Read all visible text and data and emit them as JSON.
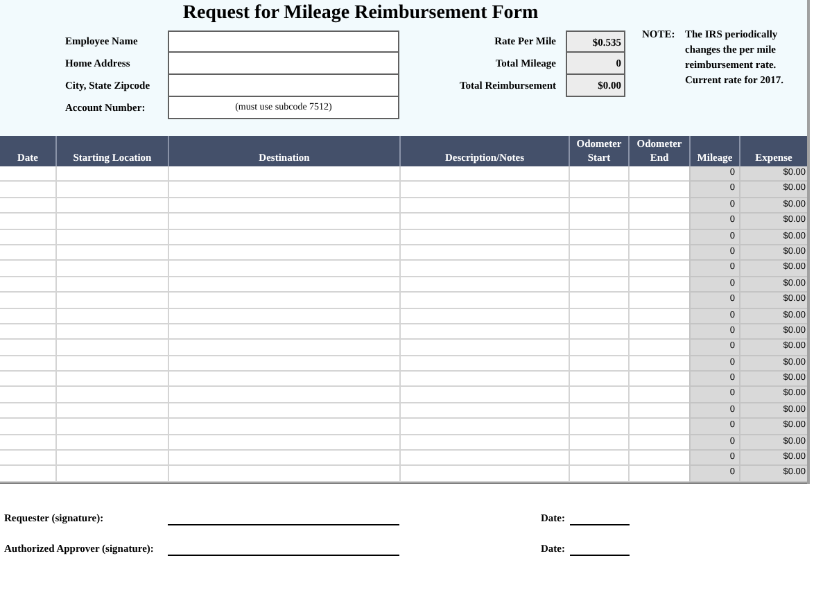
{
  "title": "Request for Mileage Reimbursement Form",
  "employee_fields": [
    {
      "label": "Employee Name"
    },
    {
      "label": "Home Address"
    },
    {
      "label": "City, State Zipcode"
    },
    {
      "label": "Account Number:",
      "value": "(must use subcode 7512)"
    }
  ],
  "summary_fields": [
    {
      "label": "Rate Per Mile",
      "value": "$0.535"
    },
    {
      "label": "Total Mileage",
      "value": "0"
    },
    {
      "label": "Total Reimbursement",
      "value": "$0.00"
    }
  ],
  "note": {
    "label": "NOTE:",
    "lines": [
      "The IRS periodically",
      "changes the per mile",
      "reimbursement rate.",
      "Current rate for 2017."
    ]
  },
  "table": {
    "columns": [
      [
        "Date"
      ],
      [
        "Starting Location"
      ],
      [
        "Destination"
      ],
      [
        "Description/Notes"
      ],
      [
        "Odometer",
        "Start"
      ],
      [
        "Odometer",
        "End"
      ],
      [
        "Mileage"
      ],
      [
        "Expense"
      ]
    ],
    "rows": [
      {
        "mileage": "0",
        "expense": "$0.00"
      },
      {
        "mileage": "0",
        "expense": "$0.00"
      },
      {
        "mileage": "0",
        "expense": "$0.00"
      },
      {
        "mileage": "0",
        "expense": "$0.00"
      },
      {
        "mileage": "0",
        "expense": "$0.00"
      },
      {
        "mileage": "0",
        "expense": "$0.00"
      },
      {
        "mileage": "0",
        "expense": "$0.00"
      },
      {
        "mileage": "0",
        "expense": "$0.00"
      },
      {
        "mileage": "0",
        "expense": "$0.00"
      },
      {
        "mileage": "0",
        "expense": "$0.00"
      },
      {
        "mileage": "0",
        "expense": "$0.00"
      },
      {
        "mileage": "0",
        "expense": "$0.00"
      },
      {
        "mileage": "0",
        "expense": "$0.00"
      },
      {
        "mileage": "0",
        "expense": "$0.00"
      },
      {
        "mileage": "0",
        "expense": "$0.00"
      },
      {
        "mileage": "0",
        "expense": "$0.00"
      },
      {
        "mileage": "0",
        "expense": "$0.00"
      },
      {
        "mileage": "0",
        "expense": "$0.00"
      },
      {
        "mileage": "0",
        "expense": "$0.00"
      },
      {
        "mileage": "0",
        "expense": "$0.00"
      }
    ]
  },
  "signatures": [
    {
      "label": "Requester (signature):",
      "date_label": "Date:"
    },
    {
      "label": "Authorized Approver (signature):",
      "date_label": "Date:"
    }
  ]
}
